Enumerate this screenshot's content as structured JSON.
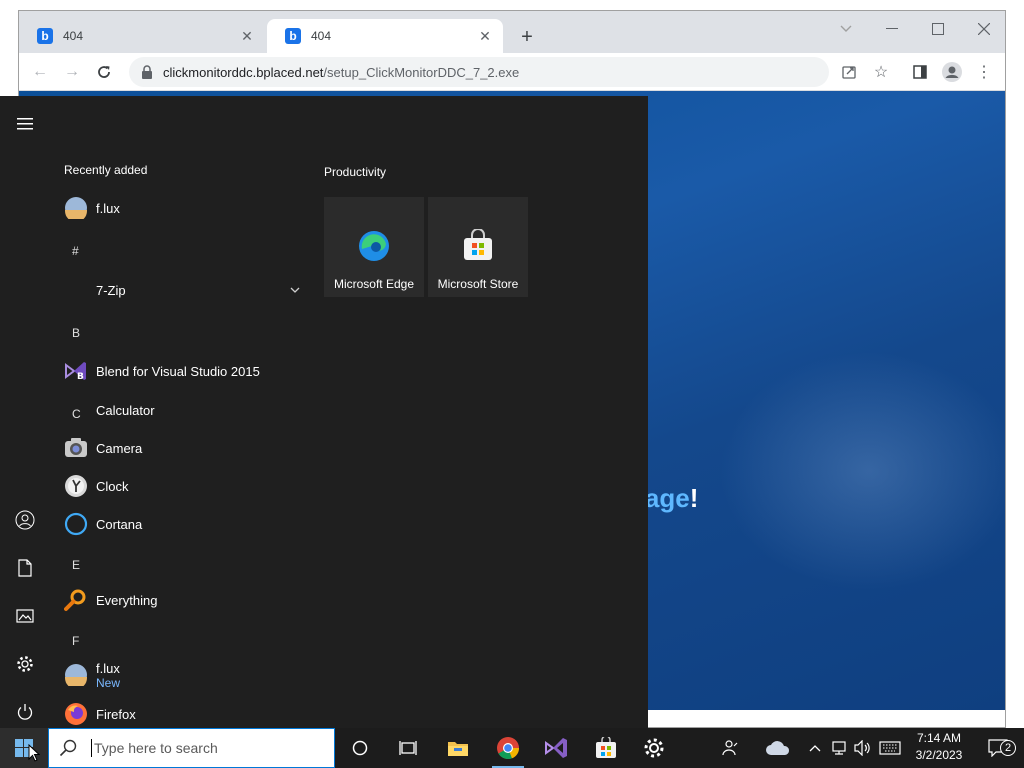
{
  "browser": {
    "tabs": [
      {
        "favicon": "b",
        "title": "404"
      },
      {
        "favicon": "b",
        "title": "404"
      }
    ],
    "omnibox": {
      "domain": "clickmonitorddc.bplaced.net",
      "path": "/setup_ClickMonitorDDC_7_2.exe"
    },
    "page": {
      "headline_word": "page",
      "headline_punct": "!"
    }
  },
  "start_menu": {
    "recently_added_label": "Recently added",
    "productivity_label": "Productivity",
    "recent_apps": [
      {
        "name": "f.lux",
        "icon": "flux-icon"
      }
    ],
    "groups": [
      {
        "letter": "#",
        "apps": [
          {
            "name": "7-Zip",
            "icon": "folder-icon",
            "expandable": true
          }
        ]
      },
      {
        "letter": "B",
        "apps": [
          {
            "name": "Blend for Visual Studio 2015",
            "icon": "blend-icon"
          }
        ]
      },
      {
        "letter": "C",
        "apps": [
          {
            "name": "Calculator",
            "icon": "calculator-icon"
          },
          {
            "name": "Camera",
            "icon": "camera-icon"
          },
          {
            "name": "Clock",
            "icon": "clock-icon"
          },
          {
            "name": "Cortana",
            "icon": "cortana-icon"
          }
        ]
      },
      {
        "letter": "E",
        "apps": [
          {
            "name": "Everything",
            "icon": "magnifier-icon"
          }
        ]
      },
      {
        "letter": "F",
        "apps": [
          {
            "name": "f.lux",
            "badge": "New",
            "icon": "flux-icon"
          },
          {
            "name": "Firefox",
            "icon": "firefox-icon"
          }
        ]
      }
    ],
    "tiles": [
      {
        "label": "Microsoft Edge",
        "icon": "edge-icon"
      },
      {
        "label": "Microsoft Store",
        "icon": "store-icon"
      }
    ],
    "rail_icons": [
      "hamburger-icon",
      "user-icon",
      "document-icon",
      "pictures-icon",
      "settings-icon",
      "power-icon"
    ]
  },
  "taskbar": {
    "search_placeholder": "Type here to search",
    "time": "7:14 AM",
    "date": "3/2/2023",
    "notification_count": "2",
    "accent": "#0078d7"
  }
}
